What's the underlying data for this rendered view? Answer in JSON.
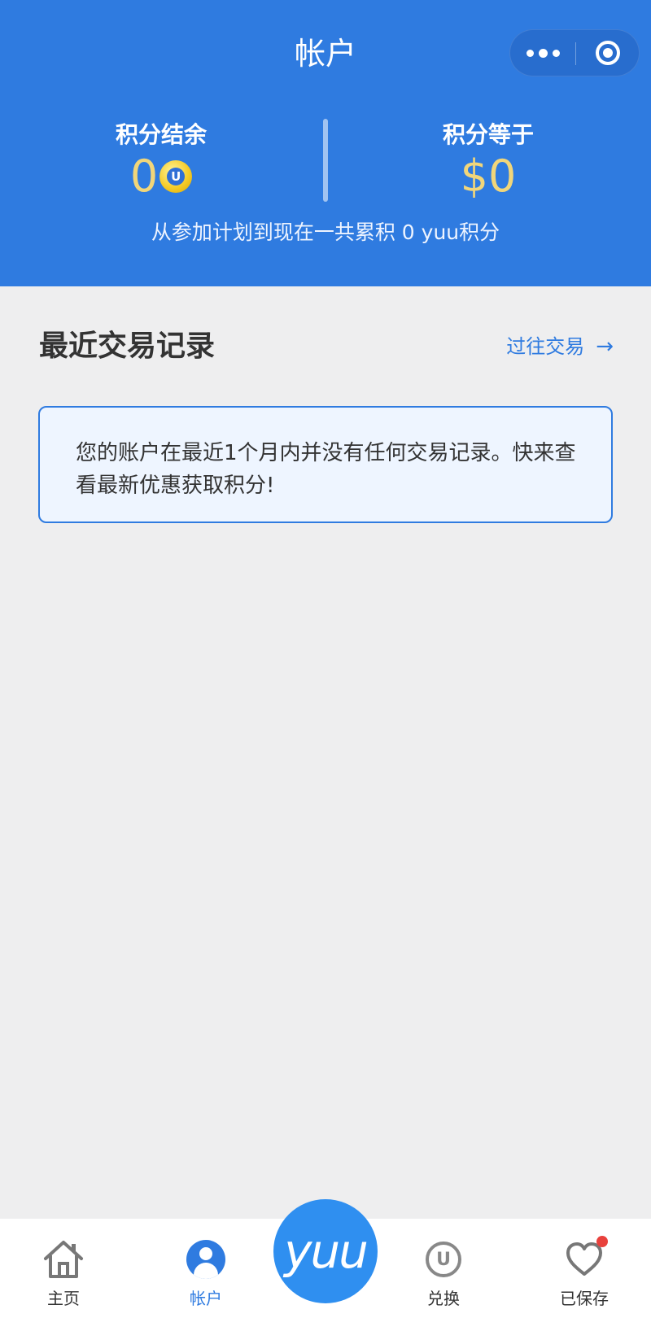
{
  "header": {
    "title": "帐户",
    "bg_color": "#2f7be0",
    "capsule": {
      "more_icon": "more-dots-icon",
      "close_icon": "target-icon"
    }
  },
  "points": {
    "balance_label": "积分结余",
    "balance_value": "0",
    "balance_icon": "yuu-coin-icon",
    "equivalent_label": "积分等于",
    "equivalent_value": "$0",
    "summary": "从参加计划到现在一共累积 0 yuu积分"
  },
  "transactions": {
    "title": "最近交易记录",
    "history_link": "过往交易",
    "history_arrow": "→",
    "empty_message": "您的账户在最近1个月内并没有任何交易记录。快来查看最新优惠获取积分!"
  },
  "tabbar": {
    "tabs": [
      {
        "label": "主页",
        "icon": "home-icon",
        "active": false
      },
      {
        "label": "帐户",
        "icon": "user-icon",
        "active": true
      },
      {
        "label": "兑换",
        "icon": "redeem-u-icon",
        "active": false
      },
      {
        "label": "已保存",
        "icon": "heart-icon",
        "active": false,
        "badge": true
      }
    ],
    "center_button": {
      "text": "yuu",
      "icon": "yuu-logo"
    },
    "active_color": "#2f7be0",
    "badge_color": "#e8413c"
  }
}
